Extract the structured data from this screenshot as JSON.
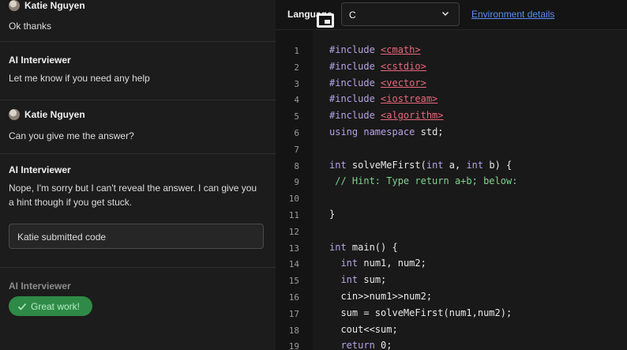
{
  "chat": {
    "messages": [
      {
        "author": "Katie Nguyen",
        "text": "Ok thanks"
      },
      {
        "author": "AI Interviewer",
        "text": "Let me know if you need any help"
      },
      {
        "author": "Katie Nguyen",
        "text": "Can you give me the answer?"
      },
      {
        "author": "AI Interviewer",
        "text": "Nope, I'm sorry but I can't reveal the answer. I can give you a hint though if you get stuck."
      }
    ],
    "submitted_box": "Katie submitted code",
    "last_author": "AI Interviewer",
    "last_badge": "Great work!"
  },
  "editor": {
    "language_label": "Language",
    "language_value": "C",
    "env_link": "Environment details",
    "line_numbers": [
      "1",
      "2",
      "3",
      "4",
      "5",
      "6",
      "7",
      "8",
      "9",
      "10",
      "11",
      "12",
      "13",
      "14",
      "15",
      "16",
      "17",
      "18",
      "19"
    ],
    "code": [
      {
        "pre": "#include ",
        "hdr": "<cmath>"
      },
      {
        "pre": "#include ",
        "hdr": "<cstdio>"
      },
      {
        "pre": "#include ",
        "hdr": "<vector>"
      },
      {
        "pre": "#include ",
        "hdr": "<iostream>"
      },
      {
        "pre": "#include ",
        "hdr": "<algorithm>"
      },
      {
        "text": "using namespace std;"
      },
      {
        "text": ""
      },
      {
        "text": "int solveMeFirst(int a, int b) {"
      },
      {
        "comment": " // Hint: Type return a+b; below:"
      },
      {
        "text": ""
      },
      {
        "text": "}"
      },
      {
        "text": ""
      },
      {
        "text": "int main() {"
      },
      {
        "text": "  int num1, num2;"
      },
      {
        "text": "  int sum;"
      },
      {
        "text": "  cin>>num1>>num2;"
      },
      {
        "text": "  sum = solveMeFirst(num1,num2);"
      },
      {
        "text": "  cout<<sum;"
      },
      {
        "text": "  return 0;"
      }
    ]
  },
  "colors": {
    "keyword": "#b7a3e8",
    "header": "#e8687a",
    "comment": "#7fd38c",
    "link": "#5b8df0",
    "badge": "#2e8a46"
  }
}
